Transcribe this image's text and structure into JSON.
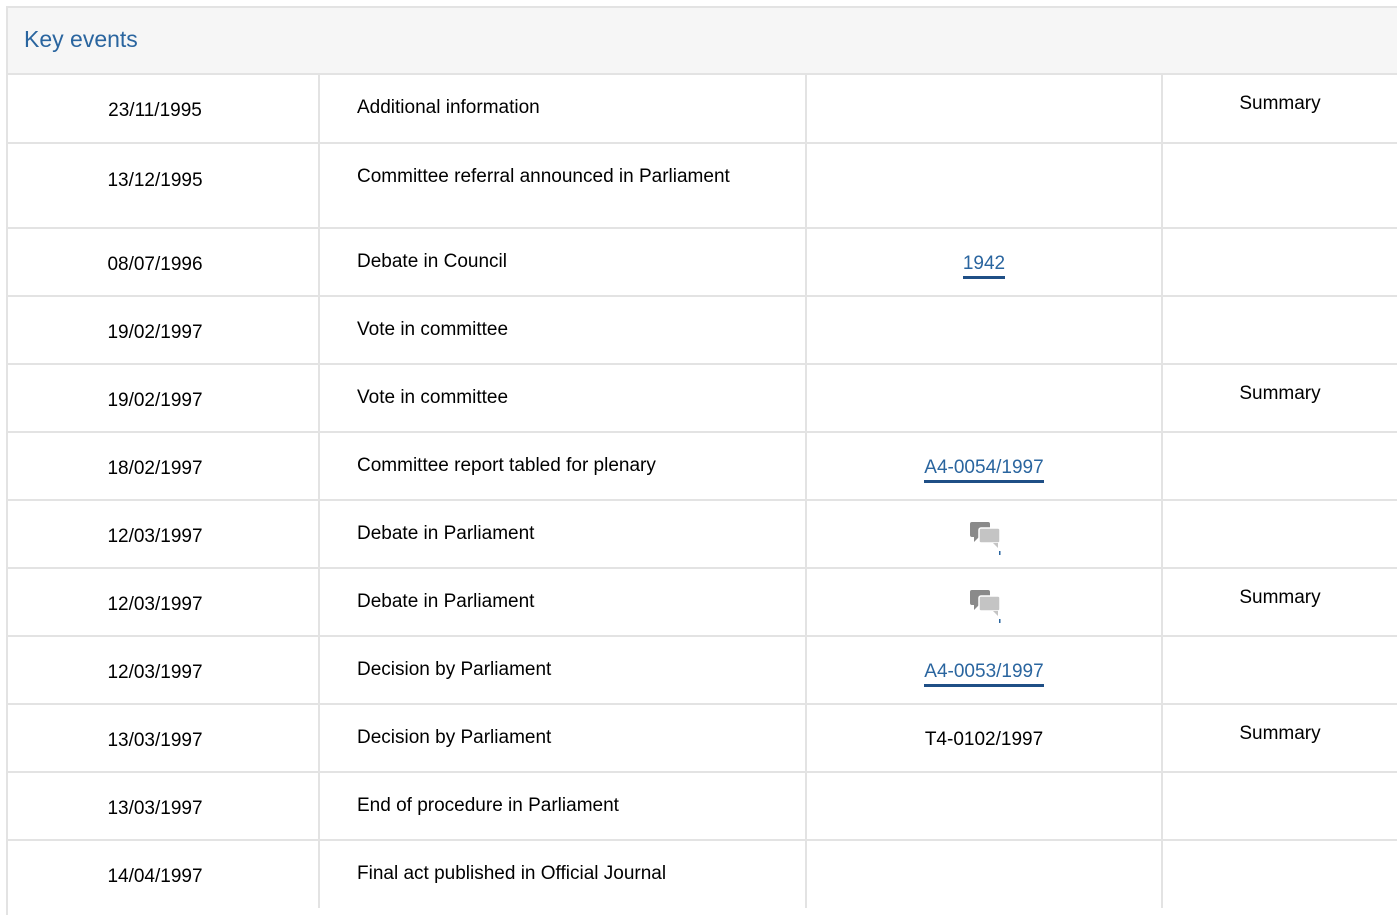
{
  "header": {
    "title": "Key events"
  },
  "rows": [
    {
      "date": "23/11/1995",
      "event": "Additional information",
      "ref": "",
      "summary": "Summary"
    },
    {
      "date": "13/12/1995",
      "event": "Committee referral announced in Parliament",
      "ref": "",
      "summary": ""
    },
    {
      "date": "08/07/1996",
      "event": "Debate in Council",
      "ref": "1942",
      "summary": ""
    },
    {
      "date": "19/02/1997",
      "event": "Vote in committee",
      "ref": "",
      "summary": ""
    },
    {
      "date": "19/02/1997",
      "event": "Vote in committee",
      "ref": "",
      "summary": "Summary"
    },
    {
      "date": "18/02/1997",
      "event": "Committee report tabled for plenary",
      "ref": "A4-0054/1997",
      "summary": ""
    },
    {
      "date": "12/03/1997",
      "event": "Debate in Parliament",
      "ref": "",
      "summary": ""
    },
    {
      "date": "12/03/1997",
      "event": "Debate in Parliament",
      "ref": "",
      "summary": "Summary"
    },
    {
      "date": "12/03/1997",
      "event": "Decision by Parliament",
      "ref": "A4-0053/1997",
      "summary": ""
    },
    {
      "date": "13/03/1997",
      "event": "Decision by Parliament",
      "ref": "T4-0102/1997",
      "summary": "Summary"
    },
    {
      "date": "13/03/1997",
      "event": "End of procedure in Parliament",
      "ref": "",
      "summary": ""
    },
    {
      "date": "14/04/1997",
      "event": "Final act published in Official Journal",
      "ref": "",
      "summary": ""
    }
  ],
  "icons": {
    "debate": "speech-bubbles-icon"
  },
  "colors": {
    "link": "#2a659f",
    "link_underline": "#1f4f86",
    "border": "#e3e3e3",
    "header_bg": "#f6f6f6"
  }
}
